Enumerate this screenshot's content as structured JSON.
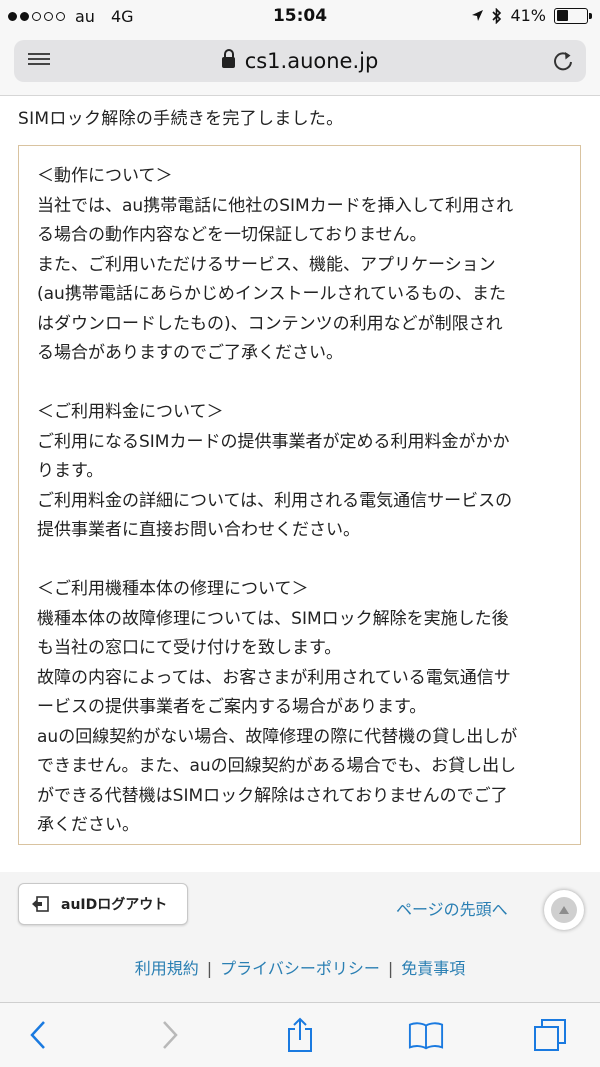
{
  "status_bar": {
    "carrier": "au",
    "network": "4G",
    "time": "15:04",
    "battery": "41%",
    "battery_level": 0.41,
    "signal_bars_filled": 2,
    "signal_bars_total": 5
  },
  "address_bar": {
    "url": "cs1.auone.jp"
  },
  "content": {
    "intro": "SIMロック解除の手続きを完了しました。",
    "sections": [
      {
        "heading": "＜動作について＞",
        "lines": [
          "当社では、au携帯電話に他社のSIMカードを挿入して利用され",
          "る場合の動作内容などを一切保証しておりません。",
          "また、ご利用いただけるサービス、機能、アプリケーション",
          "(au携帯電話にあらかじめインストールされているもの、また",
          "はダウンロードしたもの)、コンテンツの利用などが制限され",
          "る場合がありますのでご了承ください。"
        ]
      },
      {
        "heading": "＜ご利用料金について＞",
        "lines": [
          "ご利用になるSIMカードの提供事業者が定める利用料金がかか",
          "ります。",
          "ご利用料金の詳細については、利用される電気通信サービスの",
          "提供事業者に直接お問い合わせください。"
        ]
      },
      {
        "heading": "＜ご利用機種本体の修理について＞",
        "lines": [
          "機種本体の故障修理については、SIMロック解除を実施した後",
          "も当社の窓口にて受け付けを致します。",
          "故障の内容によっては、お客さまが利用されている電気通信サ",
          "ービスの提供事業者をご案内する場合があります。",
          "auの回線契約がない場合、故障修理の際に代替機の貸し出しが",
          "できません。また、auの回線契約がある場合でも、お貸し出し",
          "ができる代替機はSIMロック解除はされておりませんのでご了",
          "承ください。"
        ]
      }
    ]
  },
  "footer": {
    "logout_label": "auIDログアウト",
    "page_top_label": "ページの先頭へ",
    "links": [
      "利用規約",
      "プライバシーポリシー",
      "免責事項"
    ],
    "separator": "|"
  },
  "colors": {
    "link": "#2a7fb3",
    "box_border": "#d9c3a0",
    "toolbar_icon": "#1a7ae0",
    "toolbar_icon_disabled": "#b9b9b9"
  },
  "icons": {
    "reader": "reader-view-icon",
    "lock": "lock-icon",
    "reload": "reload-icon",
    "logout": "logout-icon",
    "page_top": "arrow-up-icon",
    "back": "chevron-left-icon",
    "forward": "chevron-right-icon",
    "share": "share-icon",
    "bookmarks": "book-icon",
    "tabs": "tabs-icon"
  }
}
